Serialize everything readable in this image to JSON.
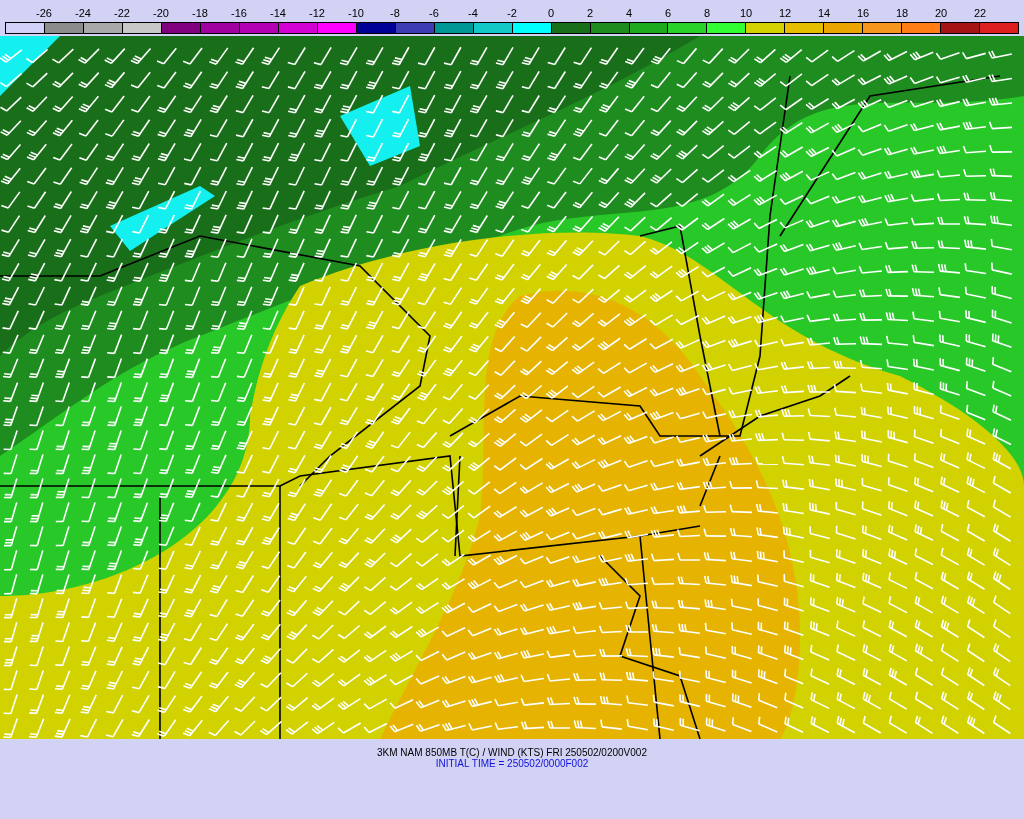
{
  "color_bar": {
    "labels": [
      "-26",
      "-24",
      "-22",
      "-20",
      "-18",
      "-16",
      "-14",
      "-12",
      "-10",
      "-8",
      "-6",
      "-4",
      "-2",
      "0",
      "2",
      "4",
      "6",
      "8",
      "10",
      "12",
      "14",
      "16",
      "18",
      "20",
      "22"
    ],
    "swatches": [
      {
        "color": "#d0d0f8"
      },
      {
        "color": "#8c8c8c"
      },
      {
        "color": "#a9a9a9"
      },
      {
        "color": "#c8c8c8"
      },
      {
        "color": "#800080"
      },
      {
        "color": "#a000a0"
      },
      {
        "color": "#b400b4"
      },
      {
        "color": "#d200d2"
      },
      {
        "color": "#ff00ff"
      },
      {
        "color": "#000096"
      },
      {
        "color": "#3c3cb4"
      },
      {
        "color": "#009696"
      },
      {
        "color": "#14c8c8"
      },
      {
        "color": "#00ffff"
      },
      {
        "color": "#196e19"
      },
      {
        "color": "#1e8c1e"
      },
      {
        "color": "#1eaa1e"
      },
      {
        "color": "#28d228"
      },
      {
        "color": "#32ff32"
      },
      {
        "color": "#d2d200"
      },
      {
        "color": "#e6be00"
      },
      {
        "color": "#eba500"
      },
      {
        "color": "#f5961e"
      },
      {
        "color": "#ff7d14"
      },
      {
        "color": "#a51414"
      },
      {
        "color": "#dc1e1e"
      }
    ]
  },
  "footer": {
    "title": "3KM NAM 850MB T(C) / WIND (KTS) FRI 250502/0200V002",
    "initial_time": "INITIAL TIME = 250502/0000F002"
  }
}
